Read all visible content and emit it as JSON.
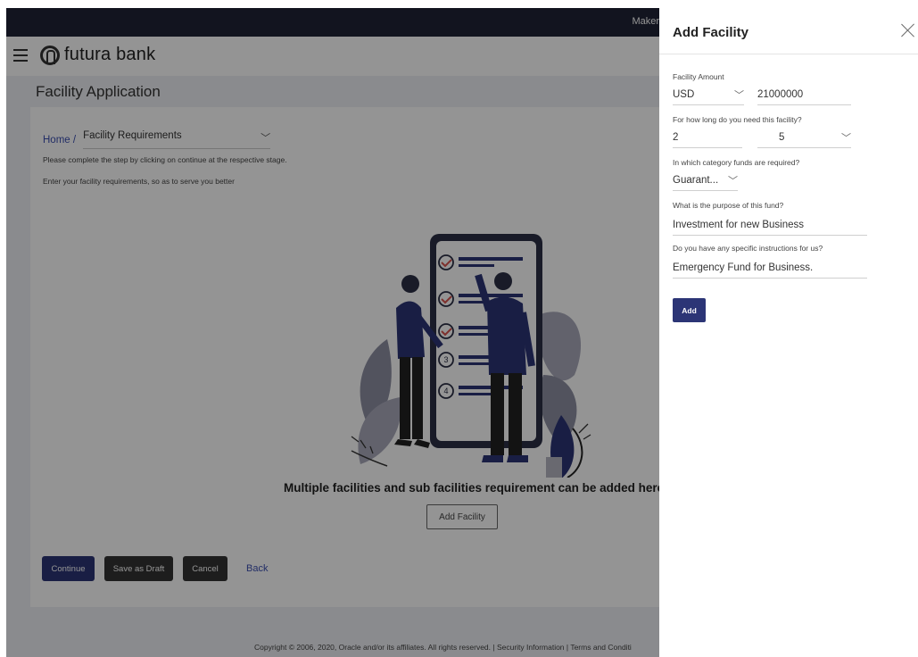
{
  "header": {
    "user": "Maker"
  },
  "brand": {
    "name": "futura bank"
  },
  "page": {
    "title": "Facility Application"
  },
  "breadcrumb": {
    "home": "Home /",
    "current": "Facility Requirements"
  },
  "notes": {
    "step": "Please complete the step by clicking on continue at the respective stage.",
    "enter": "Enter your facility requirements, so as to serve you better"
  },
  "illustration": {
    "steps": [
      "3",
      "4"
    ]
  },
  "main": {
    "message": "Multiple facilities and sub facilities requirement can be added here",
    "add_facility": "Add Facility"
  },
  "actions": {
    "continue": "Continue",
    "save_draft": "Save as Draft",
    "cancel": "Cancel",
    "back": "Back"
  },
  "footer": {
    "copyright": "Copyright © 2006, 2020, Oracle and/or its affiliates. All rights reserved. | Security Information | Terms and Conditi"
  },
  "panel": {
    "title": "Add Facility",
    "amount_label": "Facility Amount",
    "currency": "USD",
    "amount": "21000000",
    "duration_label": "For how long do you need this facility?",
    "duration_value": "2",
    "duration_unit": "5",
    "category_label": "In which category funds are required?",
    "category": "Guarant...",
    "purpose_label": "What is the purpose of this fund?",
    "purpose": "Investment for new Business",
    "instructions_label": "Do you have any specific instructions for us?",
    "instructions": "Emergency Fund for Business.",
    "add": "Add"
  }
}
